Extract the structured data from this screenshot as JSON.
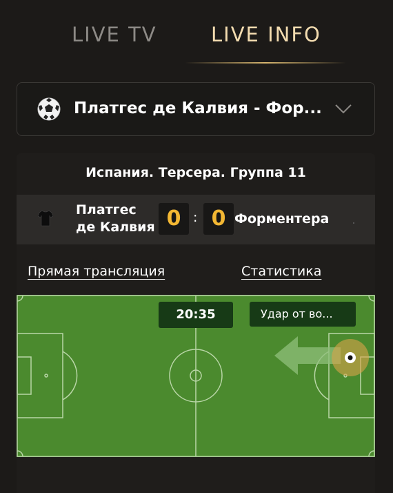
{
  "tabs": {
    "live_tv": "LIVE TV",
    "live_info": "LIVE INFO"
  },
  "match_select": {
    "icon": "soccer-ball-icon",
    "label": "Платгес де Калвия - Фор...",
    "chevron": "chevron-down-icon"
  },
  "league": "Испания. Терсера. Группа 11",
  "match": {
    "home_team": "Платгес де Калвия",
    "away_team": "Форментера",
    "home_score": "0",
    "separator": ":",
    "away_score": "0",
    "home_icon": "jersey-icon"
  },
  "links": {
    "live": "Прямая трансляция",
    "stats": "Статистика"
  },
  "pitch": {
    "time": "20:35",
    "event": "Удар от во...",
    "colors": {
      "grass": "#4b8a2e",
      "lines": "#b9d6a7",
      "accent": "#f3b733"
    }
  }
}
